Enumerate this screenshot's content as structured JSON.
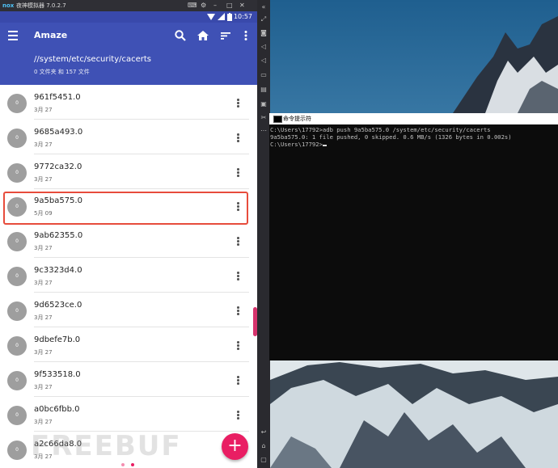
{
  "emulator": {
    "logo": "nox",
    "title": "夜神模拟器 7.0.2.7"
  },
  "statusbar": {
    "time": "10:57"
  },
  "app": {
    "title": "Amaze",
    "path": "//system/etc/security/cacerts",
    "count": "0 文件夹 和 157 文件"
  },
  "files": [
    {
      "avatar": "0",
      "name": "961f5451.0",
      "date": "3月 27"
    },
    {
      "avatar": "0",
      "name": "9685a493.0",
      "date": "3月 27"
    },
    {
      "avatar": "0",
      "name": "9772ca32.0",
      "date": "3月 27"
    },
    {
      "avatar": "0",
      "name": "9a5ba575.0",
      "date": "5月 09",
      "selected": true
    },
    {
      "avatar": "0",
      "name": "9ab62355.0",
      "date": "3月 27"
    },
    {
      "avatar": "0",
      "name": "9c3323d4.0",
      "date": "3月 27"
    },
    {
      "avatar": "0",
      "name": "9d6523ce.0",
      "date": "3月 27"
    },
    {
      "avatar": "0",
      "name": "9dbefe7b.0",
      "date": "3月 27"
    },
    {
      "avatar": "0",
      "name": "9f533518.0",
      "date": "3月 27"
    },
    {
      "avatar": "0",
      "name": "a0bc6fbb.0",
      "date": "3月 27"
    },
    {
      "avatar": "0",
      "name": "a2c66da8.0",
      "date": "3月 27"
    }
  ],
  "fab": {
    "label": "+"
  },
  "cmd": {
    "title": "命令提示符",
    "lines": [
      "C:\\Users\\17792>adb push 9a5ba575.0 /system/etc/security/cacerts",
      "9a5ba575.0: 1 file pushed, 0 skipped. 0.6 MB/s (1326 bytes in 0.002s)",
      "",
      "C:\\Users\\17792>"
    ]
  },
  "watermark": "FREEBUF",
  "colors": {
    "appbar": "#3f51b5",
    "statusbar": "#3949ab",
    "accent": "#e91e63",
    "highlight": "#e74c3c"
  },
  "icons": {
    "appbar": [
      "menu-icon",
      "search-icon",
      "home-icon",
      "sort-icon",
      "overflow-icon"
    ],
    "sidebar": [
      "expand-icon",
      "screenshot-icon",
      "volume-up-icon",
      "volume-down-icon",
      "screen-icon",
      "apk-icon",
      "toolbox-icon",
      "scissors-icon",
      "more-icon",
      "back-icon",
      "home-icon",
      "recents-icon"
    ]
  }
}
